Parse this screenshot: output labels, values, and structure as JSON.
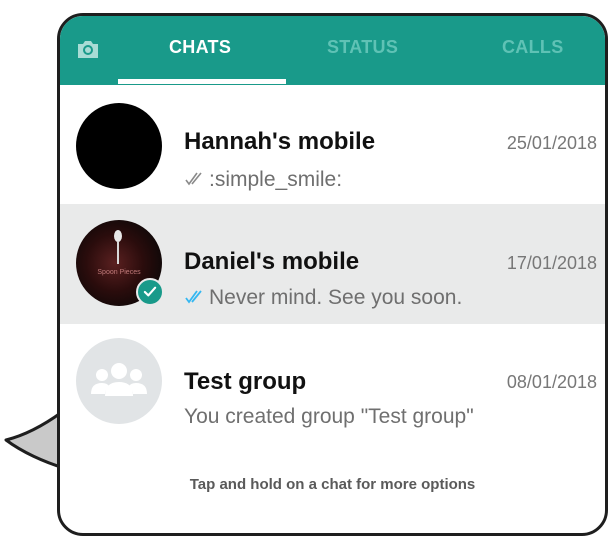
{
  "tabs": {
    "camera_icon": "camera-icon",
    "chats_label": "CHATS",
    "status_label": "STATUS",
    "calls_label": "CALLS",
    "active": "CHATS"
  },
  "colors": {
    "accent": "#199a8a",
    "selected_row": "#e9eaea",
    "read_ticks": "#34b7f1",
    "sent_ticks": "#8a8a8a"
  },
  "chats": [
    {
      "name": "Hannah's mobile",
      "date": "25/01/2018",
      "preview": ":simple_smile:",
      "ticks": "double-tick-grey-icon",
      "selected": false
    },
    {
      "name": "Daniel's mobile",
      "date": "17/01/2018",
      "preview": "Never mind. See you soon.",
      "ticks": "double-tick-blue-icon",
      "selected": true,
      "avatar_caption": "Spoon Pieces"
    },
    {
      "name": "Test group",
      "date": "08/01/2018",
      "preview": "You created group \"Test group\"",
      "avatar_icon": "group-icon",
      "selected": false
    }
  ],
  "hint": "Tap and hold on a chat for more options"
}
